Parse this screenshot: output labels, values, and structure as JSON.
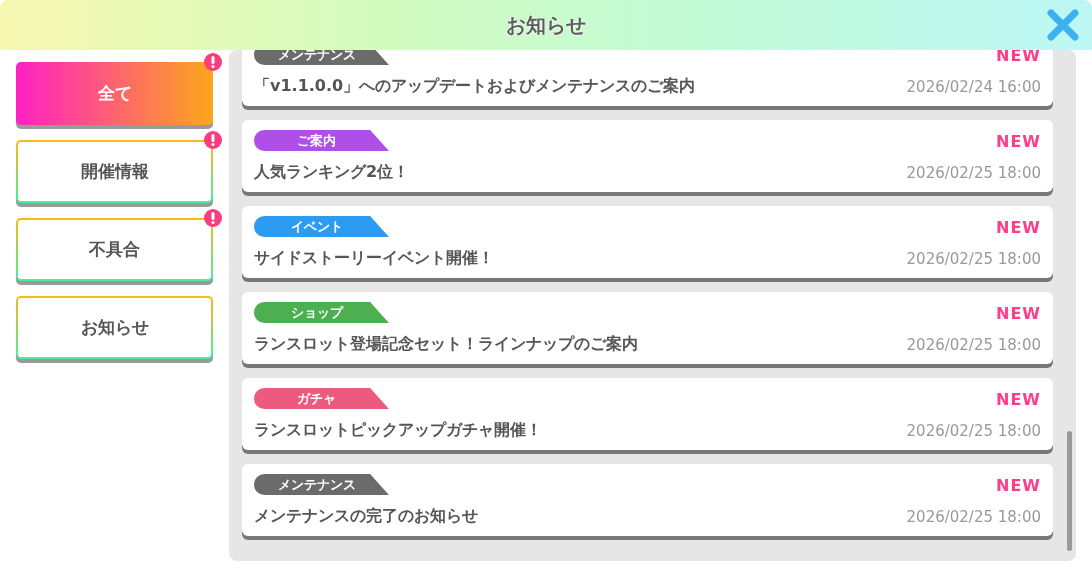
{
  "window": {
    "title": "お知らせ"
  },
  "sidebar": {
    "items": [
      {
        "label": "全て",
        "selected": true,
        "alert": true
      },
      {
        "label": "開催情報",
        "selected": false,
        "alert": true
      },
      {
        "label": "不具合",
        "selected": false,
        "alert": true
      },
      {
        "label": "お知らせ",
        "selected": false,
        "alert": false
      }
    ]
  },
  "notices": [
    {
      "tag": "メンテナンス",
      "color": "#6b6b6b",
      "new": true,
      "new_label": "NEW",
      "title": "「v1.1.0.0」へのアップデートおよびメンテナンスのご案内",
      "date": "2026/02/24 16:00"
    },
    {
      "tag": "ご案内",
      "color": "#b04ee8",
      "new": true,
      "new_label": "NEW",
      "title": "人気ランキング2位！",
      "date": "2026/02/25 18:00"
    },
    {
      "tag": "イベント",
      "color": "#2c9cf3",
      "new": true,
      "new_label": "NEW",
      "title": "サイドストーリーイベント開催！",
      "date": "2026/02/25 18:00"
    },
    {
      "tag": "ショップ",
      "color": "#4caf50",
      "new": true,
      "new_label": "NEW",
      "title": "ランスロット登場記念セット！ラインナップのご案内",
      "date": "2026/02/25 18:00"
    },
    {
      "tag": "ガチャ",
      "color": "#ec5a7e",
      "new": true,
      "new_label": "NEW",
      "title": "ランスロットピックアップガチャ開催！",
      "date": "2026/02/25 18:00"
    },
    {
      "tag": "メンテナンス",
      "color": "#6b6b6b",
      "new": true,
      "new_label": "NEW",
      "title": "メンテナンスの完了のお知らせ",
      "date": "2026/02/25 18:00"
    }
  ]
}
